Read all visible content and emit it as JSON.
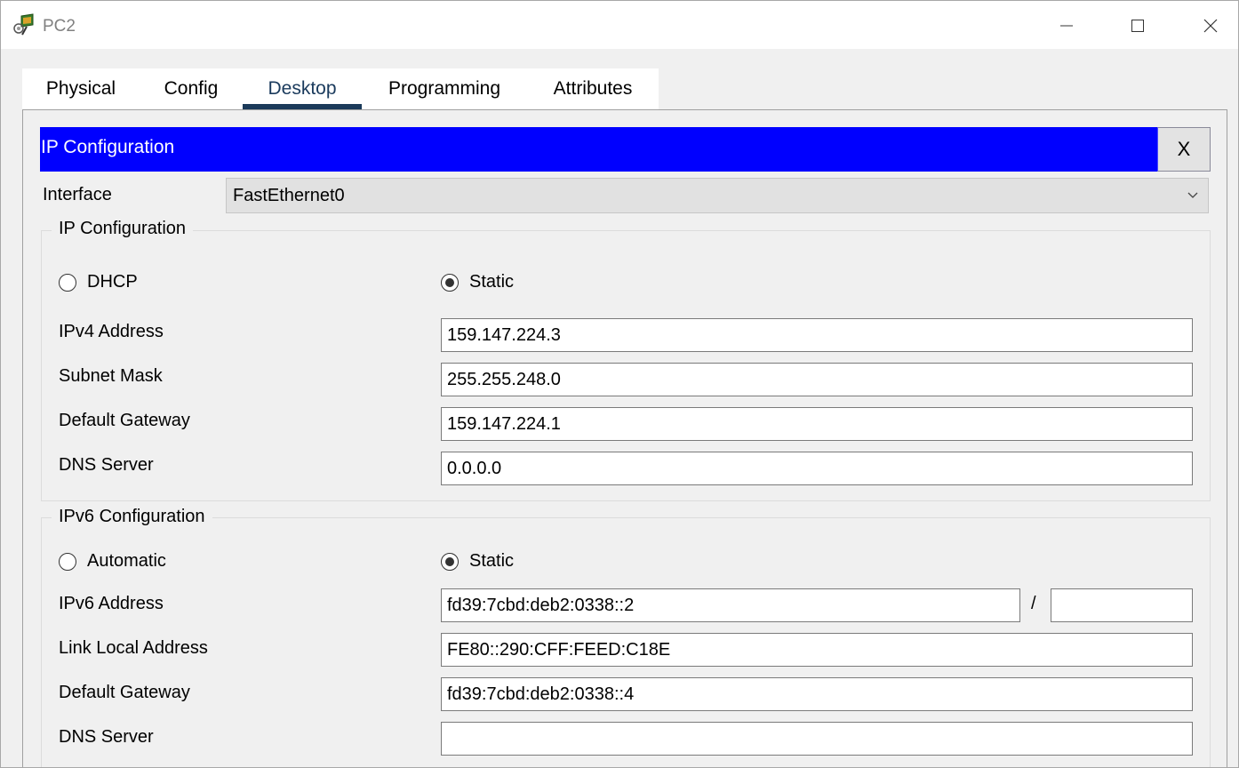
{
  "window": {
    "title": "PC2"
  },
  "tabs": [
    {
      "label": "Physical"
    },
    {
      "label": "Config"
    },
    {
      "label": "Desktop"
    },
    {
      "label": "Programming"
    },
    {
      "label": "Attributes"
    }
  ],
  "active_tab": "Desktop",
  "ip_config": {
    "header_title": "IP Configuration",
    "close_label": "X",
    "interface_label": "Interface",
    "interface_value": "FastEthernet0",
    "ipv4": {
      "group_title": "IP Configuration",
      "dhcp_label": "DHCP",
      "static_label": "Static",
      "selected_mode": "Static",
      "address_label": "IPv4 Address",
      "address_value": "159.147.224.3",
      "mask_label": "Subnet Mask",
      "mask_value": "255.255.248.0",
      "gateway_label": "Default Gateway",
      "gateway_value": "159.147.224.1",
      "dns_label": "DNS Server",
      "dns_value": "0.0.0.0"
    },
    "ipv6": {
      "group_title": "IPv6 Configuration",
      "auto_label": "Automatic",
      "static_label": "Static",
      "selected_mode": "Static",
      "address_label": "IPv6 Address",
      "address_value": "fd39:7cbd:deb2:0338::2",
      "prefix_separator": "/",
      "prefix_value": "",
      "link_local_label": "Link Local Address",
      "link_local_value": "FE80::290:CFF:FEED:C18E",
      "gateway_label": "Default Gateway",
      "gateway_value": "fd39:7cbd:deb2:0338::4",
      "dns_label": "DNS Server",
      "dns_value": ""
    }
  },
  "colors": {
    "header_bar": "#0000ff",
    "active_tab_underline": "#1b3a5a"
  },
  "icons": [
    "pc-app-icon",
    "minimize-icon",
    "maximize-icon",
    "close-window-icon",
    "chevron-down-icon"
  ]
}
